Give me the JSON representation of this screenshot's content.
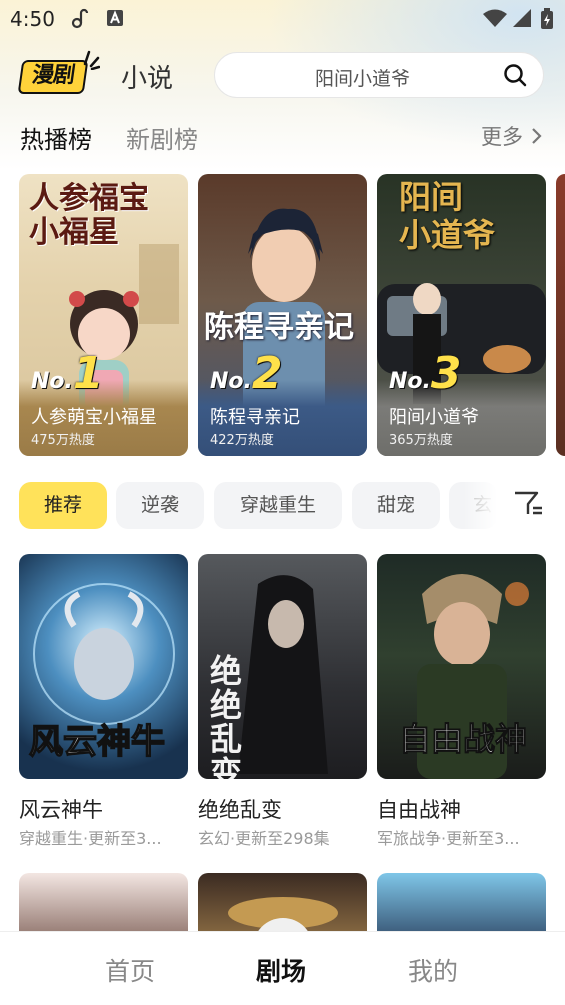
{
  "status_bar": {
    "time": "4:50"
  },
  "header": {
    "logo": "漫剧",
    "novel_tab": "小说",
    "search_placeholder": "阳间小道爷"
  },
  "ranking": {
    "tabs": [
      "热播榜",
      "新剧榜"
    ],
    "more": "更多",
    "items": [
      {
        "no_prefix": "No.",
        "rank": "1",
        "title": "人参萌宝小福星",
        "heat": "475万热度",
        "cover_text": "人参福宝\n小福星"
      },
      {
        "no_prefix": "No.",
        "rank": "2",
        "title": "陈程寻亲记",
        "heat": "422万热度",
        "cover_text": "陈程寻亲记"
      },
      {
        "no_prefix": "No.",
        "rank": "3",
        "title": "阳间小道爷",
        "heat": "365万热度",
        "cover_text": "阳间\n小道爷"
      }
    ]
  },
  "categories": [
    "推荐",
    "逆袭",
    "穿越重生",
    "甜宠",
    "玄"
  ],
  "grid": [
    {
      "title": "风云神牛",
      "sub": "穿越重生·更新至3...",
      "cover_text": "风云神牛"
    },
    {
      "title": "绝绝乱变",
      "sub": "玄幻·更新至298集",
      "cover_text": "绝绝乱变"
    },
    {
      "title": "自由战神",
      "sub": "军旅战争·更新至3...",
      "cover_text": "自由战神"
    }
  ],
  "bottom_nav": [
    "首页",
    "剧场",
    "我的"
  ],
  "colors": {
    "accent": "#ffe25a",
    "rank_gold": "#ffe14a"
  }
}
